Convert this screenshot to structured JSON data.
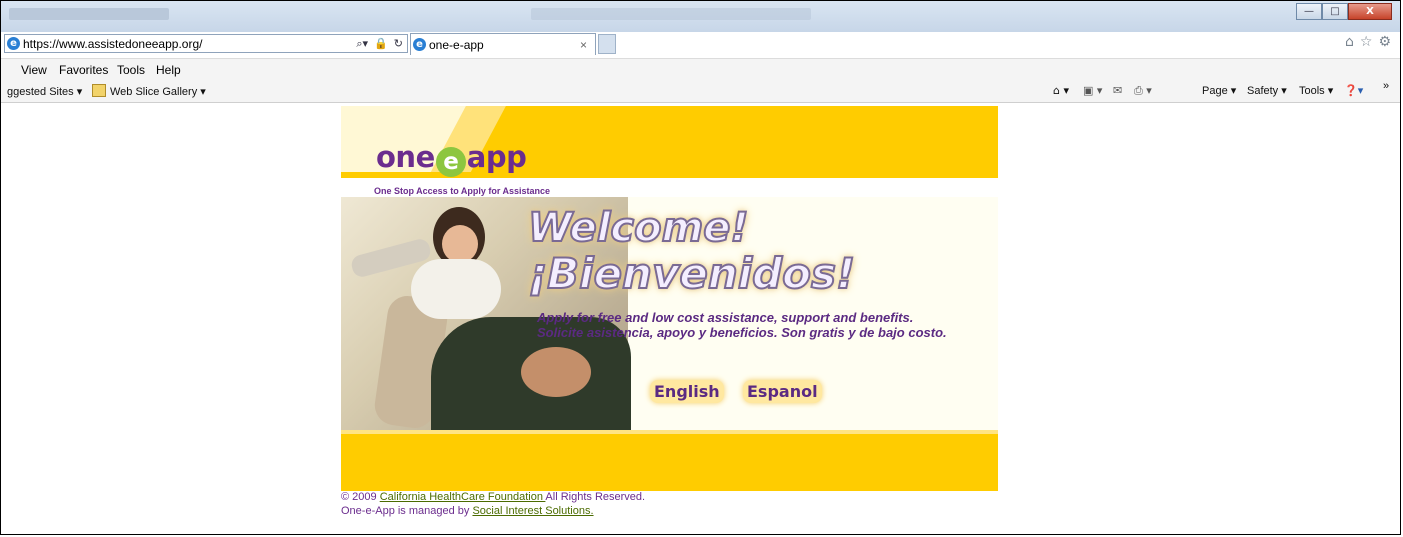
{
  "browser": {
    "address_https": "https://",
    "address_domain": "www.assistedoneeapp.org/",
    "tab_title": "one-e-app",
    "tab_close": "×",
    "window_controls": {
      "minimize": "—",
      "maximize": "□",
      "close": "X"
    },
    "menu": [
      "View",
      "Favorites",
      "Tools",
      "Help"
    ],
    "favorites": {
      "suggested": "ggested Sites ▾",
      "webslice": "Web Slice Gallery ▾"
    },
    "commands": {
      "page": "Page ▾",
      "safety": "Safety ▾",
      "tools": "Tools ▾"
    }
  },
  "site": {
    "logo_one": "one",
    "logo_e": "e",
    "logo_app": "app",
    "tagline": "One Stop Access to Apply for Assistance",
    "welcome": "Welcome!",
    "bienvenidos": "¡Bienvenidos!",
    "subtitle_en": "Apply for free and low cost assistance, support and benefits.",
    "subtitle_es": "Solicite asistencia, apoyo y beneficios. Son gratis y de bajo costo.",
    "btn_english": "English",
    "btn_espanol": "Espanol"
  },
  "footer": {
    "line1_prefix": "© 2009 ",
    "line1_link": "California HealthCare Foundation ",
    "line1_suffix": "All Rights Reserved.",
    "line2_prefix": "One-e-App is managed by ",
    "line2_link": "Social Interest Solutions."
  }
}
